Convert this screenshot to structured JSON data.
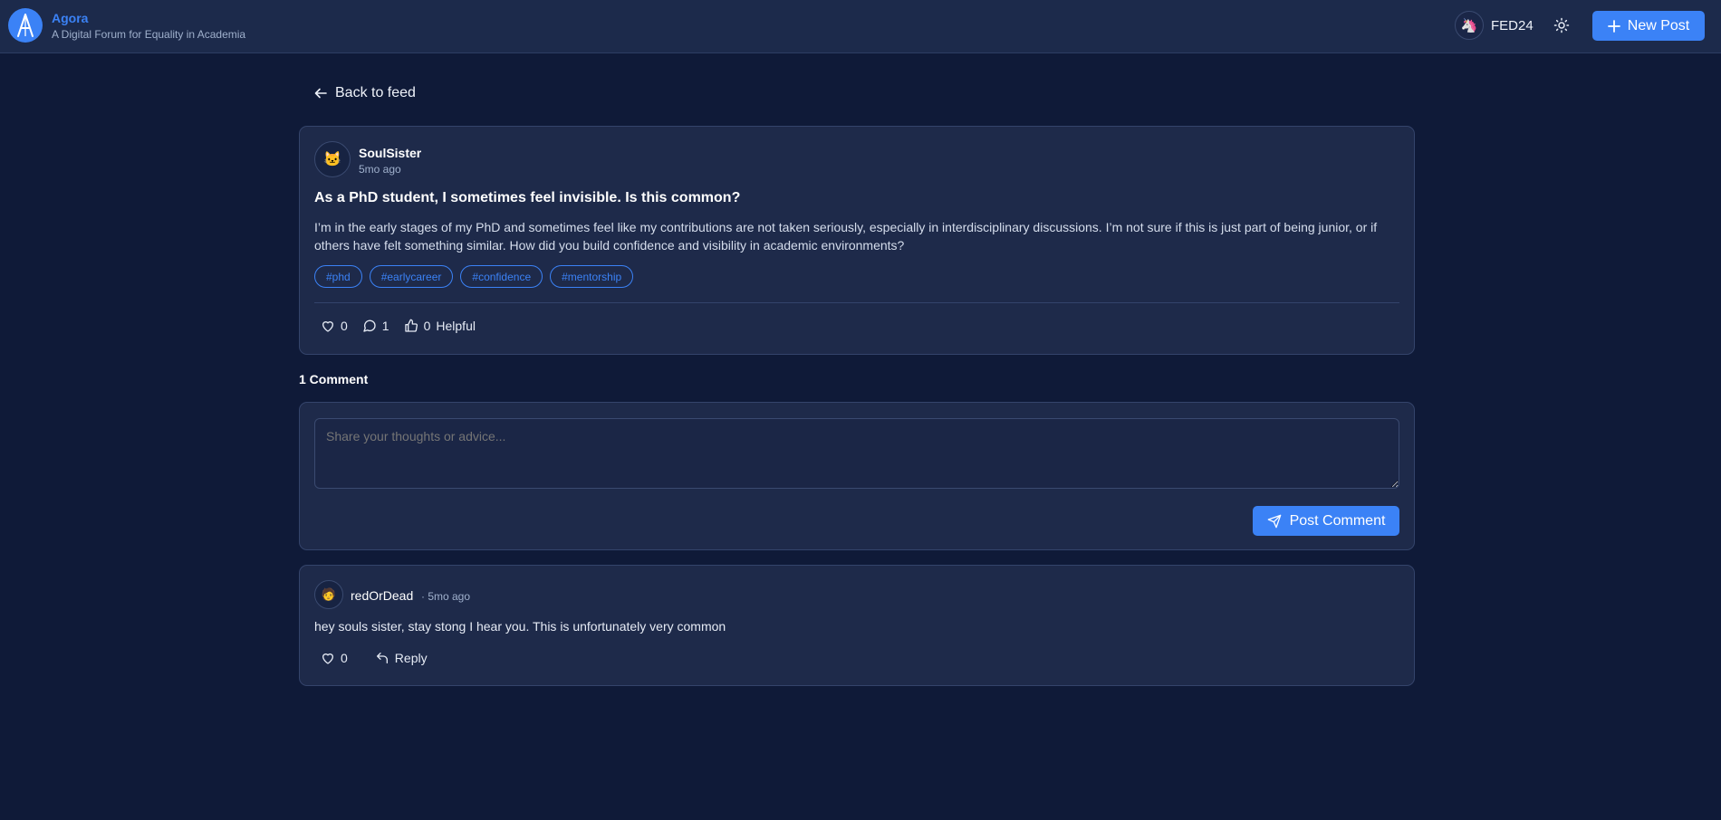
{
  "header": {
    "brand_title": "Agora",
    "brand_subtitle": "A Digital Forum for Equality in Academia",
    "user_name": "FED24",
    "new_post_label": "New Post",
    "user_avatar_icon": "unicorn-icon",
    "accent_color": "#3b82f6"
  },
  "nav": {
    "back_label": "Back to feed"
  },
  "post": {
    "author": "SoulSister",
    "time": "5mo ago",
    "avatar_icon": "cat-icon",
    "title": "As a PhD student, I sometimes feel invisible. Is this common?",
    "body": "I’m in the early stages of my PhD and sometimes feel like my contributions are not taken seriously, especially in interdisciplinary discussions. I’m not sure if this is just part of being junior, or if others have felt something similar. How did you build confidence and visibility in academic environments?",
    "tags": [
      "#phd",
      "#earlycareer",
      "#confidence",
      "#mentorship"
    ],
    "likes": "0",
    "comments": "1",
    "helpful_count": "0",
    "helpful_label": "Helpful"
  },
  "comments_section": {
    "count_label": "1 Comment",
    "input_placeholder": "Share your thoughts or advice...",
    "submit_label": "Post Comment"
  },
  "comments": [
    {
      "author": "redOrDead",
      "time": "· 5mo ago",
      "avatar_icon": "person-icon",
      "body": "hey souls sister, stay stong I hear you. This is unfortunately very common",
      "likes": "0",
      "reply_label": "Reply"
    }
  ]
}
